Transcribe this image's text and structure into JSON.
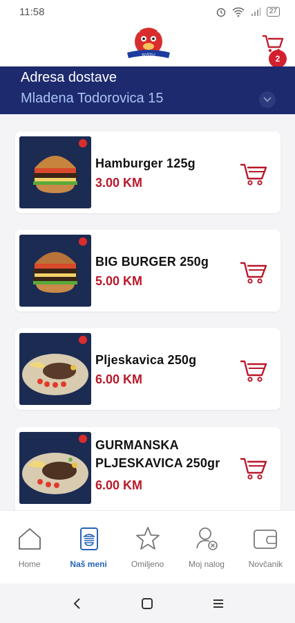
{
  "status_bar": {
    "time": "11:58",
    "battery": "27"
  },
  "header": {
    "cart_badge": "2",
    "logo_icon": "bull-logo-icon",
    "cart_icon": "cart-icon"
  },
  "address": {
    "label": "Adresa dostave",
    "value": "Mladena Todorovica 15"
  },
  "items": [
    {
      "name": "Hamburger 125g",
      "price": "3.00 KM",
      "image": "hamburger-image"
    },
    {
      "name": "BIG BURGER 250g",
      "price": "5.00 KM",
      "image": "big-burger-image"
    },
    {
      "name": "Pljeskavica 250g",
      "price": "6.00 KM",
      "image": "pljeskavica-image"
    },
    {
      "name_line1": "GURMANSKA",
      "name_line2": "PLJESKAVICA 250gr",
      "price": "6.00 KM",
      "image": "gurmanska-pljeskavica-image"
    }
  ],
  "nav": [
    {
      "label": "Home",
      "icon": "home-icon"
    },
    {
      "label": "Naš meni",
      "icon": "menu-book-icon",
      "active": true
    },
    {
      "label": "Omiljeno",
      "icon": "star-icon"
    },
    {
      "label": "Moj nalog",
      "icon": "user-icon"
    },
    {
      "label": "Novčanik",
      "icon": "wallet-icon"
    }
  ],
  "colors": {
    "primary": "#1d2a6e",
    "accent": "#b8182a",
    "active_nav": "#2563b8",
    "badge": "#d2202f"
  }
}
